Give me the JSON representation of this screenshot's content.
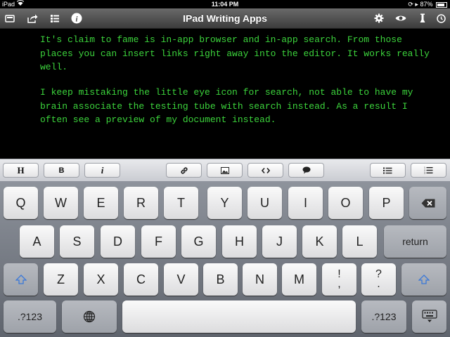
{
  "status_bar": {
    "device": "iPad",
    "time": "11:04 PM",
    "battery": "87%"
  },
  "toolbar": {
    "title": "IPad Writing Apps",
    "left_icons": [
      "files-icon",
      "share-icon",
      "outline-icon",
      "info-icon"
    ],
    "right_icons": [
      "gear-icon",
      "eye-icon",
      "test-tube-icon",
      "clock-icon"
    ]
  },
  "editor": {
    "paragraphs": [
      "It's claim to fame is in-app browser and in-app search. From those places you can insert links right away into the editor. It works really well.",
      "I keep mistaking the little eye icon for search, not able to have my brain associate the testing tube with search instead. As a result I often see a preview of my document instead."
    ]
  },
  "format_bar": {
    "heading": "H",
    "bold": "B",
    "italic": "i",
    "link_icon": "link-icon",
    "image_icon": "image-icon",
    "code_icon": "code-icon",
    "quote_icon": "quote-icon",
    "bullet_list_icon": "bullet-list-icon",
    "numbered_list_icon": "numbered-list-icon"
  },
  "keyboard": {
    "row1": [
      "Q",
      "W",
      "E",
      "R",
      "T",
      "Y",
      "U",
      "I",
      "O",
      "P"
    ],
    "row2": [
      "A",
      "S",
      "D",
      "F",
      "G",
      "H",
      "J",
      "K",
      "L"
    ],
    "row3": [
      "Z",
      "X",
      "C",
      "V",
      "B",
      "N",
      "M"
    ],
    "return": "return",
    "numbers": ".?123",
    "punct1_top": "!",
    "punct1_bottom": ",",
    "punct2_top": "?",
    "punct2_bottom": "."
  },
  "colors": {
    "editor_text": "#3cd43c",
    "editor_bg": "#000000",
    "shift_arrow": "#3a78d8"
  }
}
